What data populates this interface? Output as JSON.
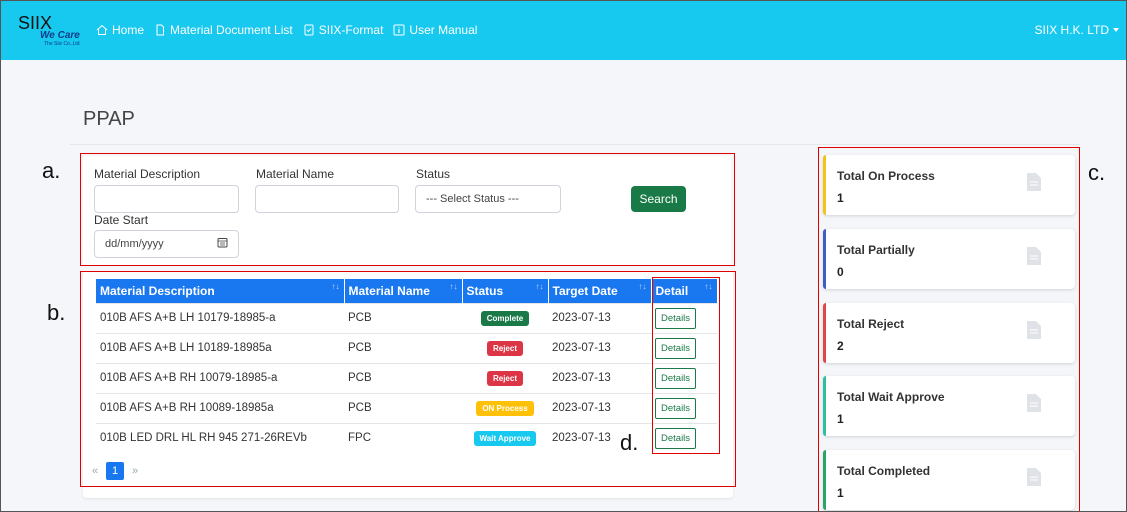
{
  "navbar": {
    "logo": {
      "main": "SIIX",
      "sub": "We Care",
      "tag": "The Siix Co.,Ltd"
    },
    "links": [
      {
        "label": "Home",
        "icon": "home-icon"
      },
      {
        "label": "Material Document List",
        "icon": "document-icon"
      },
      {
        "label": "SIIX-Format",
        "icon": "check-document-icon"
      },
      {
        "label": "User Manual",
        "icon": "info-icon"
      }
    ],
    "user": "SIIX H.K. LTD"
  },
  "page": {
    "title": "PPAP"
  },
  "filters": {
    "material_description_label": "Material Description",
    "material_description_value": "",
    "material_name_label": "Material Name",
    "material_name_value": "",
    "status_label": "Status",
    "status_value": "--- Select Status ---",
    "date_start_label": "Date Start",
    "date_start_value": "dd/mm/yyyy",
    "search_label": "Search"
  },
  "table": {
    "headers": [
      "Material Description",
      "Material Name",
      "Status",
      "Target Date",
      "Detail"
    ],
    "rows": [
      {
        "description": "010B AFS A+B LH 10179-18985-a",
        "name": "PCB",
        "status": "Complete",
        "date": "2023-07-13",
        "detail": "Details"
      },
      {
        "description": "010B AFS A+B LH 10189-18985a",
        "name": "PCB",
        "status": "Reject",
        "date": "2023-07-13",
        "detail": "Details"
      },
      {
        "description": "010B AFS A+B RH 10079-18985-a",
        "name": "PCB",
        "status": "Reject",
        "date": "2023-07-13",
        "detail": "Details"
      },
      {
        "description": "010B AFS A+B RH 10089-18985a",
        "name": "PCB",
        "status": "ON Process",
        "date": "2023-07-13",
        "detail": "Details"
      },
      {
        "description": "010B LED DRL HL RH 945 271-26REVb",
        "name": "FPC",
        "status": "Wait Approve",
        "date": "2023-07-13",
        "detail": "Details"
      }
    ]
  },
  "pagination": {
    "prev": "«",
    "current": "1",
    "next": "»"
  },
  "stats": [
    {
      "title": "Total On Process",
      "value": "1",
      "color": "#f0c419"
    },
    {
      "title": "Total Partially",
      "value": "0",
      "color": "#3f5ec4"
    },
    {
      "title": "Total Reject",
      "value": "2",
      "color": "#e04848"
    },
    {
      "title": "Total Wait Approve",
      "value": "1",
      "color": "#2ebfa0"
    },
    {
      "title": "Total Completed",
      "value": "1",
      "color": "#2aa36a"
    }
  ],
  "status_colors": {
    "Complete": "#1a7a47",
    "Reject": "#dc3545",
    "ON Process": "#ffc107",
    "Wait Approve": "#17c8ef"
  },
  "annotations": [
    "a.",
    "b.",
    "c.",
    "d."
  ]
}
